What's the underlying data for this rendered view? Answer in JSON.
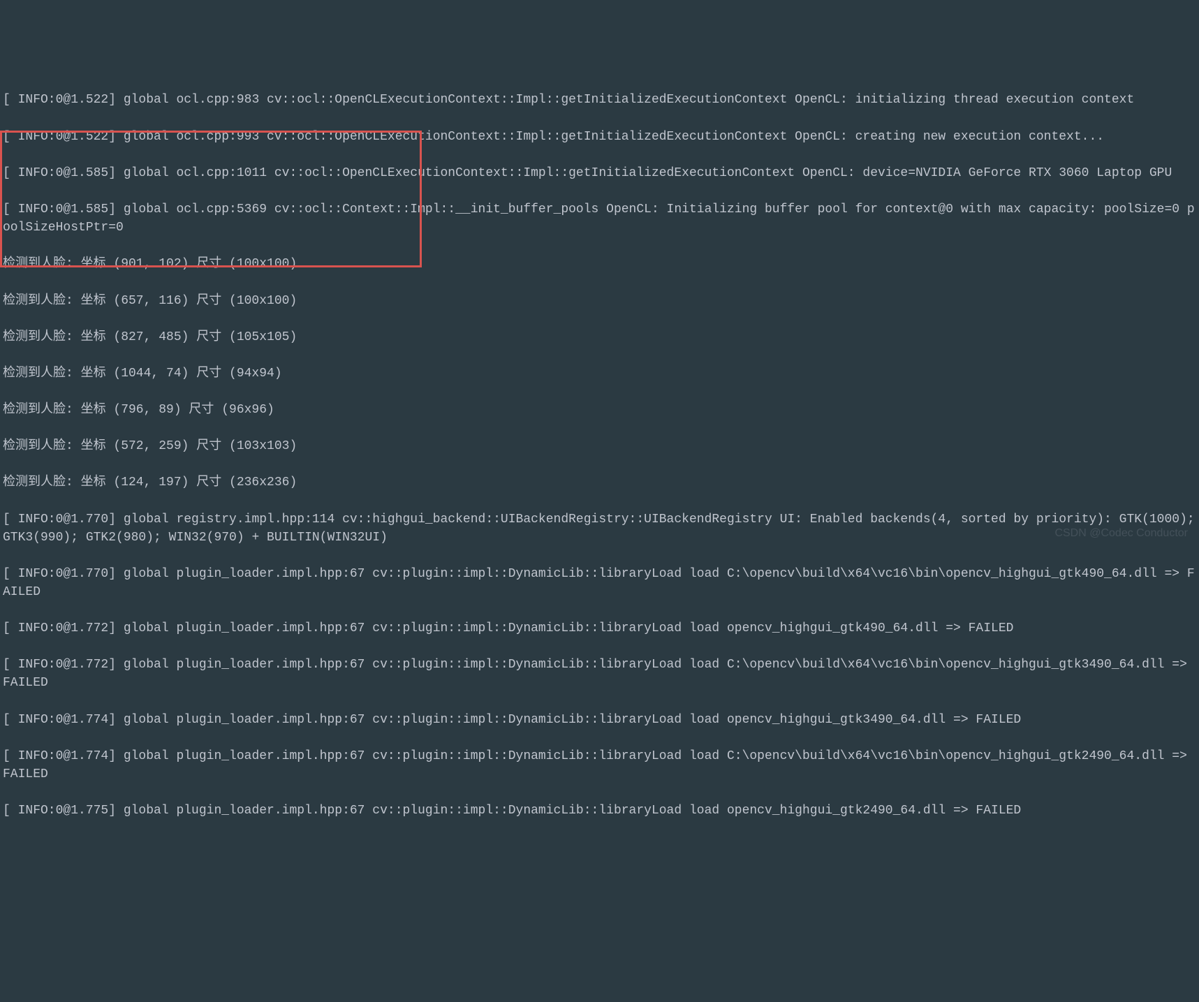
{
  "terminal": {
    "lines": [
      "[ INFO:0@1.522] global ocl.cpp:983 cv::ocl::OpenCLExecutionContext::Impl::getInitializedExecutionContext OpenCL: initializing thread execution context",
      "[ INFO:0@1.522] global ocl.cpp:993 cv::ocl::OpenCLExecutionContext::Impl::getInitializedExecutionContext OpenCL: creating new execution context...",
      "[ INFO:0@1.585] global ocl.cpp:1011 cv::ocl::OpenCLExecutionContext::Impl::getInitializedExecutionContext OpenCL: device=NVIDIA GeForce RTX 3060 Laptop GPU",
      "[ INFO:0@1.585] global ocl.cpp:5369 cv::ocl::Context::Impl::__init_buffer_pools OpenCL: Initializing buffer pool for context@0 with max capacity: poolSize=0 poolSizeHostPtr=0",
      "检测到人脸: 坐标 (901, 102) 尺寸 (100x100)",
      "检测到人脸: 坐标 (657, 116) 尺寸 (100x100)",
      "检测到人脸: 坐标 (827, 485) 尺寸 (105x105)",
      "检测到人脸: 坐标 (1044, 74) 尺寸 (94x94)",
      "检测到人脸: 坐标 (796, 89) 尺寸 (96x96)",
      "检测到人脸: 坐标 (572, 259) 尺寸 (103x103)",
      "检测到人脸: 坐标 (124, 197) 尺寸 (236x236)",
      "[ INFO:0@1.770] global registry.impl.hpp:114 cv::highgui_backend::UIBackendRegistry::UIBackendRegistry UI: Enabled backends(4, sorted by priority): GTK(1000); GTK3(990); GTK2(980); WIN32(970) + BUILTIN(WIN32UI)",
      "[ INFO:0@1.770] global plugin_loader.impl.hpp:67 cv::plugin::impl::DynamicLib::libraryLoad load C:\\opencv\\build\\x64\\vc16\\bin\\opencv_highgui_gtk490_64.dll => FAILED",
      "[ INFO:0@1.772] global plugin_loader.impl.hpp:67 cv::plugin::impl::DynamicLib::libraryLoad load opencv_highgui_gtk490_64.dll => FAILED",
      "[ INFO:0@1.772] global plugin_loader.impl.hpp:67 cv::plugin::impl::DynamicLib::libraryLoad load C:\\opencv\\build\\x64\\vc16\\bin\\opencv_highgui_gtk3490_64.dll => FAILED",
      "[ INFO:0@1.774] global plugin_loader.impl.hpp:67 cv::plugin::impl::DynamicLib::libraryLoad load opencv_highgui_gtk3490_64.dll => FAILED",
      "[ INFO:0@1.774] global plugin_loader.impl.hpp:67 cv::plugin::impl::DynamicLib::libraryLoad load C:\\opencv\\build\\x64\\vc16\\bin\\opencv_highgui_gtk2490_64.dll => FAILED",
      "[ INFO:0@1.775] global plugin_loader.impl.hpp:67 cv::plugin::impl::DynamicLib::libraryLoad load opencv_highgui_gtk2490_64.dll => FAILED"
    ]
  },
  "watermark": "CSDN @Codec Conductor",
  "highlight": {
    "color": "#d9534f"
  }
}
